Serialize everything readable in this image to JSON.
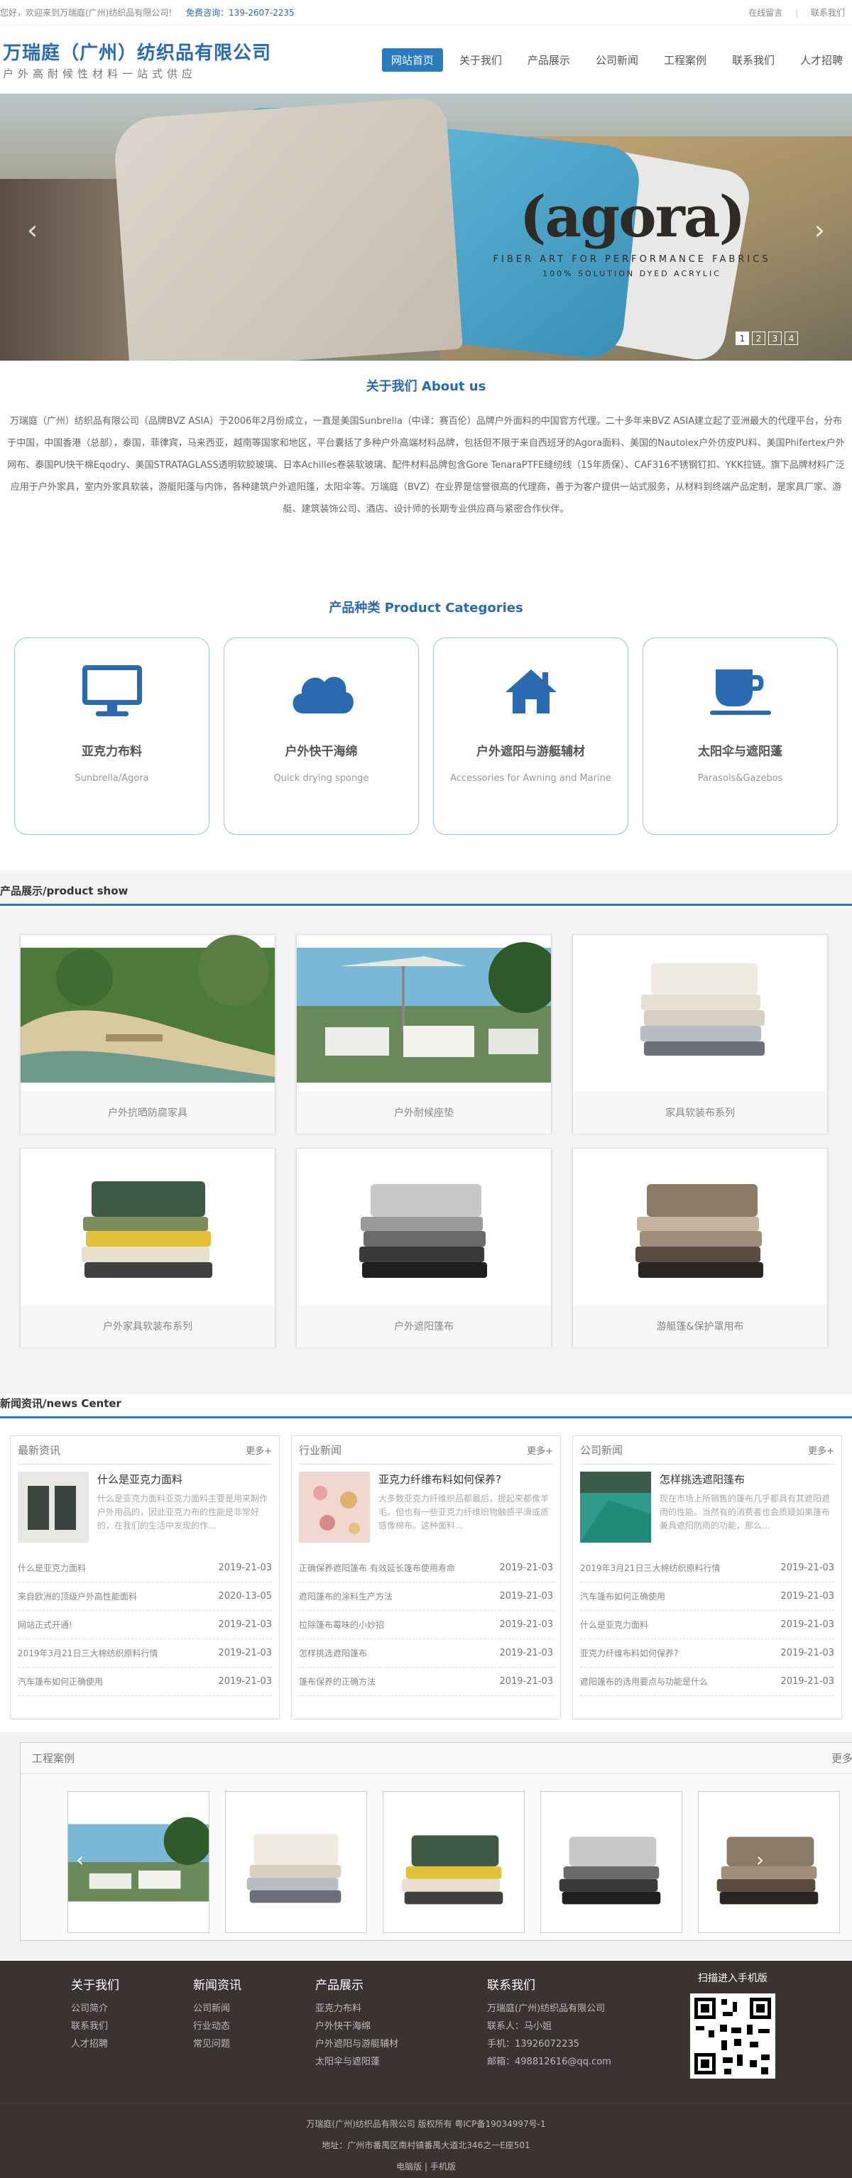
{
  "topbar": {
    "welcome": "您好，欢迎来到万瑞庭(广州)纺织品有限公司!",
    "hotline_label": "免费咨询：",
    "hotline": "139-2607-2235",
    "online_msg": "在线留言",
    "separator": "|",
    "contact": "联系我们"
  },
  "header": {
    "company": "万瑞庭（广州）纺织品有限公司",
    "slogan": "户外高耐候性材料一站式供应",
    "nav": [
      "网站首页",
      "关于我们",
      "产品展示",
      "公司新闻",
      "工程案例",
      "联系我们",
      "人才招聘"
    ]
  },
  "banner": {
    "brand": "(agora)",
    "tagline": "FIBER ART FOR PERFORMANCE FABRICS",
    "tagline2": "100% SOLUTION DYED ACRYLIC",
    "prev": "‹",
    "next": "›",
    "slides": [
      "1",
      "2",
      "3",
      "4"
    ]
  },
  "about": {
    "title": "关于我们 About us",
    "text": "万瑞庭（广州）纺织品有限公司（品牌BVZ ASIA）于2006年2月份成立，一直是美国Sunbrella（中译：赛百伦）品牌户外面料的中国官方代理。二十多年来BVZ ASIA建立起了亚洲最大的代理平台，分布于中国，中国香港（总部），泰国，菲律宾，马来西亚，越南等国家和地区，平台囊括了多种户外高端材料品牌，包括但不限于来自西班牙的Agora面料、美国的Nautolex户外仿皮PU料、美国Phifertex户外网布、泰国PU快干棉Eqodry、美国STRATAGLASS透明软胶玻璃、日本Achilles卷装软玻璃、配件材料品牌包含Gore TenaraPTFE缝纫线（15年质保）、CAF316不锈钢钉扣、YKK拉链。旗下品牌材料广泛应用于户外家具，室内外家具软装，游艇阳蓬与内饰，各种建筑户外遮阳篷，太阳伞等。万瑞庭（BVZ）在业界是信誉很高的代理商，善于为客户提供一站式服务，从材料到终端产品定制，是家具厂家、游艇、建筑装饰公司、酒店、设计师的长期专业供应商与紧密合作伙伴。"
  },
  "categories": {
    "title": "产品种类 Product Categories",
    "items": [
      {
        "name": "亚克力布料",
        "en": "Sunbrella/Agora",
        "icon": "monitor-icon"
      },
      {
        "name": "户外快干海绵",
        "en": "Quick drying sponge",
        "icon": "cloud-icon"
      },
      {
        "name": "户外遮阳与游艇辅材",
        "en": "Accessories for Awning and Marine",
        "icon": "home-icon"
      },
      {
        "name": "太阳伞与遮阳蓬",
        "en": "Parasols&Gazebos",
        "icon": "cup-icon"
      }
    ]
  },
  "products": {
    "title": "产品展示/product show",
    "items": [
      "户外抗晒防腐家具",
      "户外耐候座垫",
      "家具软装布系列",
      "户外家具软装布系列",
      "户外遮阳篷布",
      "游艇篷&保护罩用布"
    ]
  },
  "news": {
    "title": "新闻资讯/news Center",
    "more": "更多+",
    "columns": [
      {
        "name": "最新资讯",
        "feature_title": "什么是亚克力面料",
        "feature_desc": "什么是亚克力面料亚克力面料主要是用来制作户外用品的，因此亚克力布的性能是非常好的，在我们的生活中发现的作...",
        "list": [
          {
            "t": "什么是亚克力面料",
            "d": "2019-21-03"
          },
          {
            "t": "来自欧洲的顶级户外高性能面料",
            "d": "2020-13-05"
          },
          {
            "t": "网站正式开通!",
            "d": "2019-21-03"
          },
          {
            "t": "2019年3月21日三大棉纺织原料行情",
            "d": "2019-21-03"
          },
          {
            "t": "汽车篷布如何正确使用",
            "d": "2019-21-03"
          }
        ]
      },
      {
        "name": "行业新闻",
        "feature_title": "亚克力纤维布料如何保养?",
        "feature_desc": "大多数亚克力纤维织品都最后，提起来都像羊毛。但也有一些亚克力纤维织物触感平滑或质感像棉布。这种面料...",
        "list": [
          {
            "t": "正确保养遮阳篷布 有效延长篷布使用寿命",
            "d": "2019-21-03"
          },
          {
            "t": "遮阳篷布的涂料生产方法",
            "d": "2019-21-03"
          },
          {
            "t": "拉除篷布霉味的小妙招",
            "d": "2019-21-03"
          },
          {
            "t": "怎样挑选遮阳篷布",
            "d": "2019-21-03"
          },
          {
            "t": "篷布保养的正确方法",
            "d": "2019-21-03"
          }
        ]
      },
      {
        "name": "公司新闻",
        "feature_title": "怎样挑选遮阳篷布",
        "feature_desc": "现在市场上所销售的篷布几乎都具有其遮阳遮雨的性能。当然有的消费者也会质疑如果篷布兼具遮阳防雨的功能，那么...",
        "list": [
          {
            "t": "2019年3月21日三大棉纺织原料行情",
            "d": "2019-21-03"
          },
          {
            "t": "汽车篷布如何正确使用",
            "d": "2019-21-03"
          },
          {
            "t": "什么是亚克力面料",
            "d": "2019-21-03"
          },
          {
            "t": "亚克力纤维布料如何保养?",
            "d": "2019-21-03"
          },
          {
            "t": "遮阳篷布的选用要点与功能是什么",
            "d": "2019-21-03"
          }
        ]
      }
    ]
  },
  "cases": {
    "title": "工程案例",
    "more": "更多",
    "prev": "‹",
    "next": "›"
  },
  "footer": {
    "about": {
      "title": "关于我们",
      "links": [
        "公司简介",
        "联系我们",
        "人才招聘"
      ]
    },
    "news": {
      "title": "新闻资讯",
      "links": [
        "公司新闻",
        "行业动态",
        "常见问题"
      ]
    },
    "products": {
      "title": "产品展示",
      "links": [
        "亚克力布料",
        "户外快干海绵",
        "户外遮阳与游艇辅材",
        "太阳伞与遮阳蓬"
      ]
    },
    "contact": {
      "title": "联系我们",
      "company": "万瑞庭(广州)纺织品有限公司",
      "person": "联系人：马小姐",
      "phone": "手机：13926072235",
      "email": "邮箱：498812616@qq.com"
    },
    "qr_title": "扫描进入手机版",
    "copyright": "万瑞庭(广州)纺织品有限公司 版权所有 粤ICP备19034997号-1",
    "address": "地址：广州市番禺区南村镇番禺大道北346之一E座501",
    "pc": "电脑版",
    "mobile": "手机版",
    "pipe": "|"
  },
  "colors": {
    "accent": "#2a7abf",
    "footer": "#3a3331"
  }
}
